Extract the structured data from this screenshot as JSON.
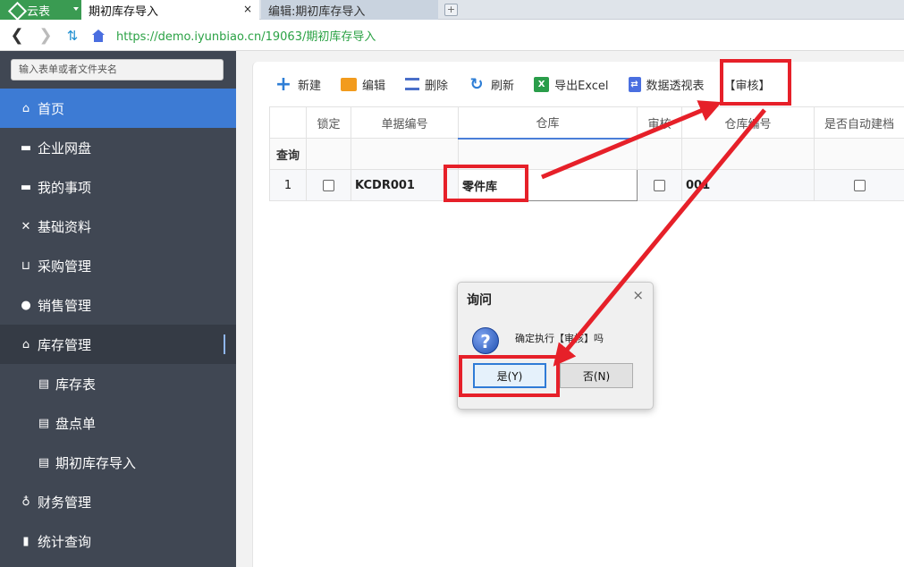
{
  "browser": {
    "app_tab": "云表",
    "tabs": [
      {
        "label": "期初库存导入",
        "active": true
      },
      {
        "label": "编辑:期初库存导入",
        "active": false
      }
    ],
    "close_glyph": "×",
    "newtab_glyph": "+",
    "url": "https://demo.iyunbiao.cn/19063/期初库存导入"
  },
  "sidebar": {
    "search_placeholder": "输入表单或者文件夹名",
    "items": [
      {
        "label": "首页",
        "icon": "home-icon",
        "glyph": "⌂",
        "state": "active"
      },
      {
        "label": "企业网盘",
        "icon": "folder-icon",
        "glyph": "▬",
        "state": ""
      },
      {
        "label": "我的事项",
        "icon": "folder-icon",
        "glyph": "▬",
        "state": ""
      },
      {
        "label": "基础资料",
        "icon": "tools-icon",
        "glyph": "✕",
        "state": ""
      },
      {
        "label": "采购管理",
        "icon": "cart-icon",
        "glyph": "⊔",
        "state": ""
      },
      {
        "label": "销售管理",
        "icon": "user-icon",
        "glyph": "●",
        "state": ""
      },
      {
        "label": "库存管理",
        "icon": "home-icon",
        "glyph": "⌂",
        "state": "expanded"
      },
      {
        "label": "库存表",
        "icon": "clipboard-icon",
        "glyph": "▤",
        "state": "sub"
      },
      {
        "label": "盘点单",
        "icon": "clipboard-icon",
        "glyph": "▤",
        "state": "sub"
      },
      {
        "label": "期初库存导入",
        "icon": "clipboard-icon",
        "glyph": "▤",
        "state": "sub"
      },
      {
        "label": "财务管理",
        "icon": "moneybag-icon",
        "glyph": "♁",
        "state": ""
      },
      {
        "label": "统计查询",
        "icon": "bar-chart-icon",
        "glyph": "▮",
        "state": ""
      }
    ]
  },
  "toolbar": {
    "new": "新建",
    "edit": "编辑",
    "delete": "删除",
    "refresh": "刷新",
    "export": "导出Excel",
    "pivot": "数据透视表",
    "audit": "【审核】",
    "plus_glyph": "+",
    "refresh_glyph": "↻",
    "excel_glyph": "X",
    "pivot_glyph": "⇄"
  },
  "grid": {
    "headers": [
      "",
      "锁定",
      "单据编号",
      "仓库",
      "审核",
      "仓库编号",
      "是否自动建档"
    ],
    "filter_label": "查询",
    "rows": [
      {
        "index": "1",
        "doc_no": "KCDR001",
        "warehouse": "零件库",
        "warehouse_no": "001"
      }
    ]
  },
  "dialog": {
    "title": "询问",
    "close_glyph": "×",
    "icon_glyph": "?",
    "message": "确定执行【审核】吗",
    "yes": "是(Y)",
    "no": "否(N)"
  },
  "annotation": {
    "color": "#e62029"
  }
}
